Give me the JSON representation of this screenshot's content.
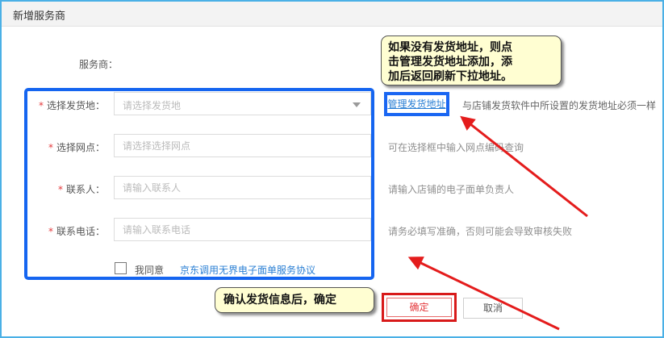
{
  "header": {
    "title": "新增服务商"
  },
  "form": {
    "provider_label": "服务商：",
    "required_mark": "*",
    "ship_from": {
      "label": "选择发货地：",
      "placeholder": "请选择发货地",
      "manage_link": "管理发货地址",
      "hint": "与店铺发货软件中所设置的发货地址必须一样"
    },
    "branch": {
      "label": "选择网点：",
      "placeholder": "请选择选择网点",
      "hint": "可在选择框中输入网点编码查询"
    },
    "contact": {
      "label": "联系人：",
      "placeholder": "请输入联系人",
      "hint": "请输入店铺的电子面单负责人"
    },
    "phone": {
      "label": "联系电话：",
      "placeholder": "请输入联系电话",
      "hint": "请务必填写准确，否则可能会导致审核失败"
    },
    "agree_label": "我同意",
    "agreement_link": "京东调用无界电子面单服务协议"
  },
  "buttons": {
    "confirm": "确定",
    "cancel": "取消"
  },
  "annotations": {
    "top_callout_lines": [
      "如果没有发货地址，则点",
      "击管理发货地址添加，添",
      "加后返回刷新下拉地址。"
    ],
    "bottom_callout": "确认发货信息后，确定"
  },
  "colors": {
    "frame": "#4ab0e6",
    "highlight_blue": "#1565f0",
    "highlight_red": "#d81a1a",
    "link": "#2a7fd4",
    "required": "#e4393c"
  }
}
